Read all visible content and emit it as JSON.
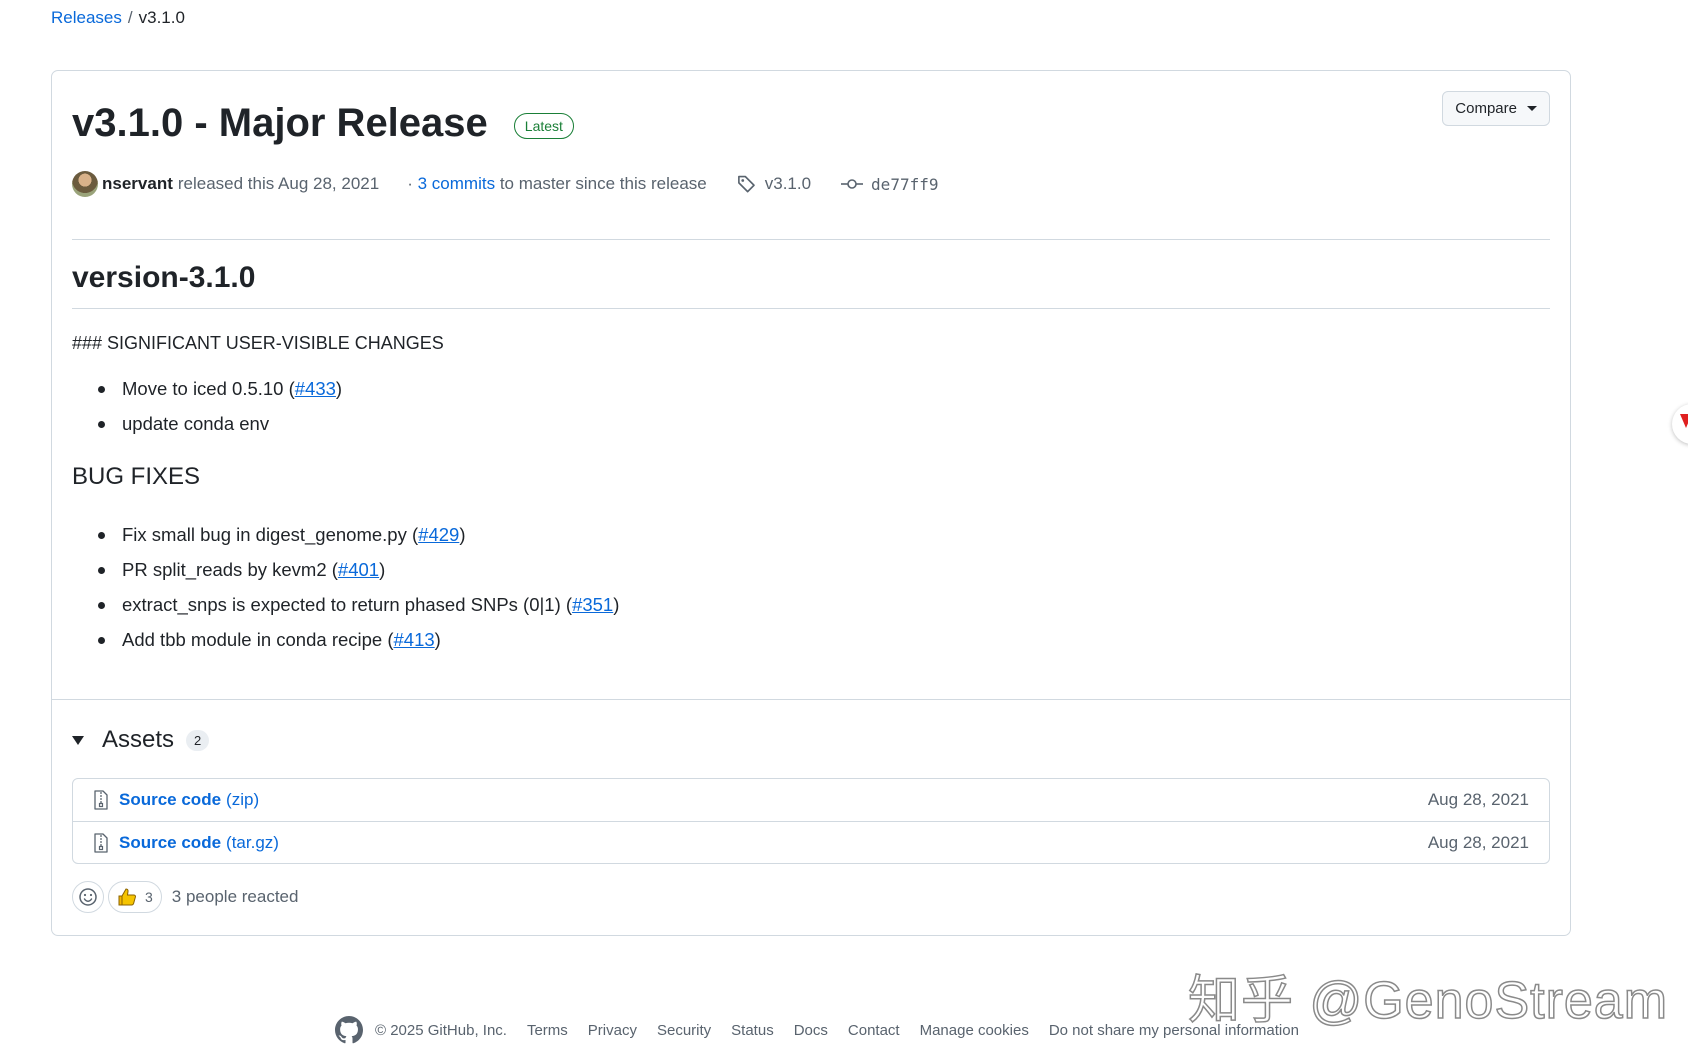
{
  "breadcrumb": {
    "parent": "Releases",
    "separator": "/",
    "current": "v3.1.0"
  },
  "release": {
    "title": "v3.1.0 - Major Release",
    "badge": "Latest",
    "compare_label": "Compare",
    "author": "nservant",
    "released_text": "released this Aug 28, 2021",
    "commits_prefix": "·",
    "commits_link": "3 commits",
    "commits_suffix": "to master since this release",
    "tag": "v3.1.0",
    "commit_sha": "de77ff9"
  },
  "notes": {
    "heading": "version-3.1.0",
    "section_text": "### SIGNIFICANT USER-VISIBLE CHANGES",
    "changes": [
      {
        "text": "Move to iced 0.5.10 (",
        "pr": "#433",
        "suffix": ")"
      },
      {
        "text": "update conda env",
        "pr": "",
        "suffix": ""
      }
    ],
    "bug_heading": "BUG FIXES",
    "bugs": [
      {
        "text": "Fix small bug in digest_genome.py (",
        "pr": "#429",
        "suffix": ")"
      },
      {
        "text": "PR split_reads by kevm2 (",
        "pr": "#401",
        "suffix": ")"
      },
      {
        "text": "extract_snps is expected to return phased SNPs (0|1) (",
        "pr": "#351",
        "suffix": ")"
      },
      {
        "text": "Add tbb module in conda recipe (",
        "pr": "#413",
        "suffix": ")"
      }
    ]
  },
  "assets": {
    "title": "Assets",
    "count": "2",
    "items": [
      {
        "name": "Source code",
        "kind": "(zip)",
        "date": "Aug 28, 2021"
      },
      {
        "name": "Source code",
        "kind": "(tar.gz)",
        "date": "Aug 28, 2021"
      }
    ]
  },
  "reactions": {
    "thumbs_count": "3",
    "summary": "3 people reacted"
  },
  "footer": {
    "copyright": "© 2025 GitHub, Inc.",
    "links": [
      "Terms",
      "Privacy",
      "Security",
      "Status",
      "Docs",
      "Contact",
      "Manage cookies",
      "Do not share my personal information"
    ]
  },
  "watermark": "知乎 @GenoStream",
  "colors": {
    "link": "#0969da",
    "badge": "#1a7f37",
    "border": "#d1d9e0",
    "muted": "#59636e"
  },
  "icons": [
    "tag-icon",
    "commit-icon",
    "file-zip-icon",
    "smiley-icon",
    "thumbs-up-icon",
    "github-mark-icon"
  ]
}
